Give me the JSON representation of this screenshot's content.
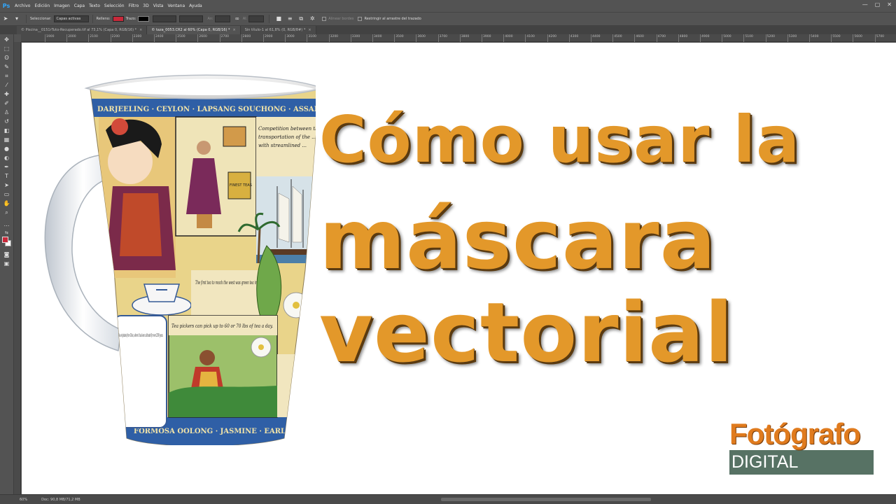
{
  "app": {
    "logo": "Ps",
    "menu": [
      "Archivo",
      "Edición",
      "Imagen",
      "Capa",
      "Texto",
      "Selección",
      "Filtro",
      "3D",
      "Vista",
      "Ventana",
      "Ayuda"
    ]
  },
  "options": {
    "select_label": "Seleccionar:",
    "select_value": "Capas activas",
    "fill_label": "Relleno:",
    "stroke_label": "Trazo:",
    "width_label": "An:",
    "height_label": "Al:",
    "align_edges": "Alinear bordes",
    "constrain": "Restringir al arrastre del trazado",
    "fill_color": "#c8293a",
    "stroke_color": "#000000"
  },
  "tabs": [
    {
      "label": "© Piscina__0151rTuto-Recuperado.tif al 73,1% (Capa 0, RGB/16) *"
    },
    {
      "label": "© taza_0053.CR2 al 60% (Capa 0, RGB/16) *"
    },
    {
      "label": "Sin título-1 al 61,8% (0, RGB/8#) *"
    }
  ],
  "ruler": {
    "marks": [
      "1900",
      "2000",
      "2100",
      "2200",
      "2300",
      "2400",
      "2500",
      "2600",
      "2700",
      "2800",
      "2900",
      "3000",
      "3100",
      "3200",
      "3300",
      "3400",
      "3500",
      "3600",
      "3700",
      "3800",
      "3900",
      "4000",
      "4100",
      "4200",
      "4300",
      "4400",
      "4500",
      "4600",
      "4700",
      "4800",
      "4900",
      "5000",
      "5100",
      "5200",
      "5300",
      "5400",
      "5500",
      "5600",
      "5700",
      "5800"
    ]
  },
  "canvas": {
    "headline": [
      "Cómo usar la",
      "máscara",
      "vectorial"
    ],
    "headline_color": "#e3982a",
    "mug": {
      "top_band": "DARJEELING · CEYLON · LAPSANG SOUCHONG · ASSAM",
      "bottom_band": "FORMOSA OOLONG · JASMINE · EARL",
      "text1": "Competition between the ...",
      "text2": "transportation of the ...",
      "text3": "with streamlined ...",
      "text4": "The first tea to reach the west was green tea in 1650.",
      "text5": "Tea pickers can pick up to 60 or 70 lbs of tea a day.",
      "text6": "Tea originates from China, where it has been cultivated for over 2500 years.",
      "crate": "FINEST TEAS"
    },
    "logo": {
      "top": "Fotógrafo",
      "bottom": "DIGITAL"
    }
  },
  "status": {
    "zoom": "60%",
    "doc": "Doc: 90,8 MB/71,2 MB"
  }
}
